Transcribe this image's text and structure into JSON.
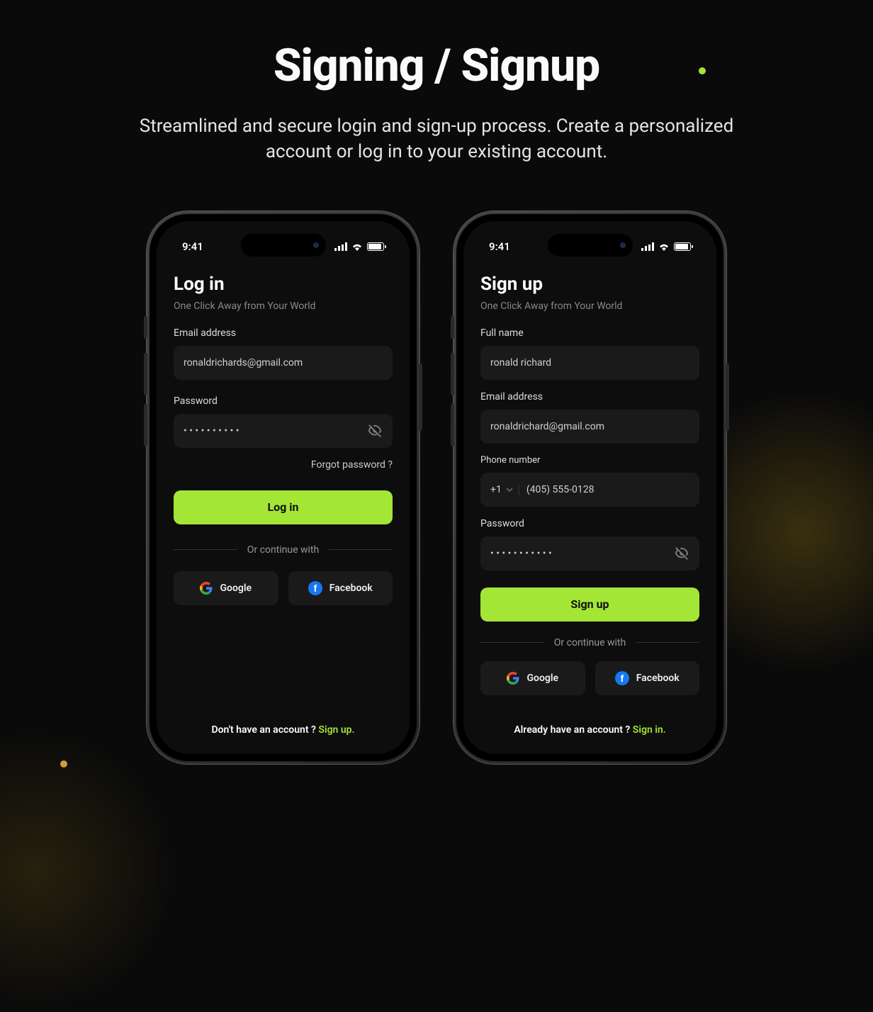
{
  "header": {
    "title": "Signing / Signup",
    "subtitle": "Streamlined and secure login and sign-up process. Create a personalized account or log in to your existing account."
  },
  "status": {
    "time": "9:41"
  },
  "login": {
    "title": "Log in",
    "subtitle": "One Click Away from Your World",
    "email_label": "Email address",
    "email_value": "ronaldrichards@gmail.com",
    "password_label": "Password",
    "password_value": "• • • • • • • • • •",
    "forgot": "Forgot password ?",
    "submit": "Log in",
    "divider": "Or continue with",
    "google": "Google",
    "facebook": "Facebook",
    "footer_text": "Don't have an account ? ",
    "footer_link": "Sign up."
  },
  "signup": {
    "title": "Sign up",
    "subtitle": "One Click Away from Your World",
    "name_label": "Full name",
    "name_value": "ronald richard",
    "email_label": "Email address",
    "email_value": "ronaldrichard@gmail.com",
    "phone_label": "Phone number",
    "country_code": "+1",
    "phone_value": "(405) 555-0128",
    "password_label": "Password",
    "password_value": "• • • • • • • • • • •",
    "submit": "Sign up",
    "divider": "Or continue with",
    "google": "Google",
    "facebook": "Facebook",
    "footer_text": "Already have an account ? ",
    "footer_link": "Sign in."
  }
}
